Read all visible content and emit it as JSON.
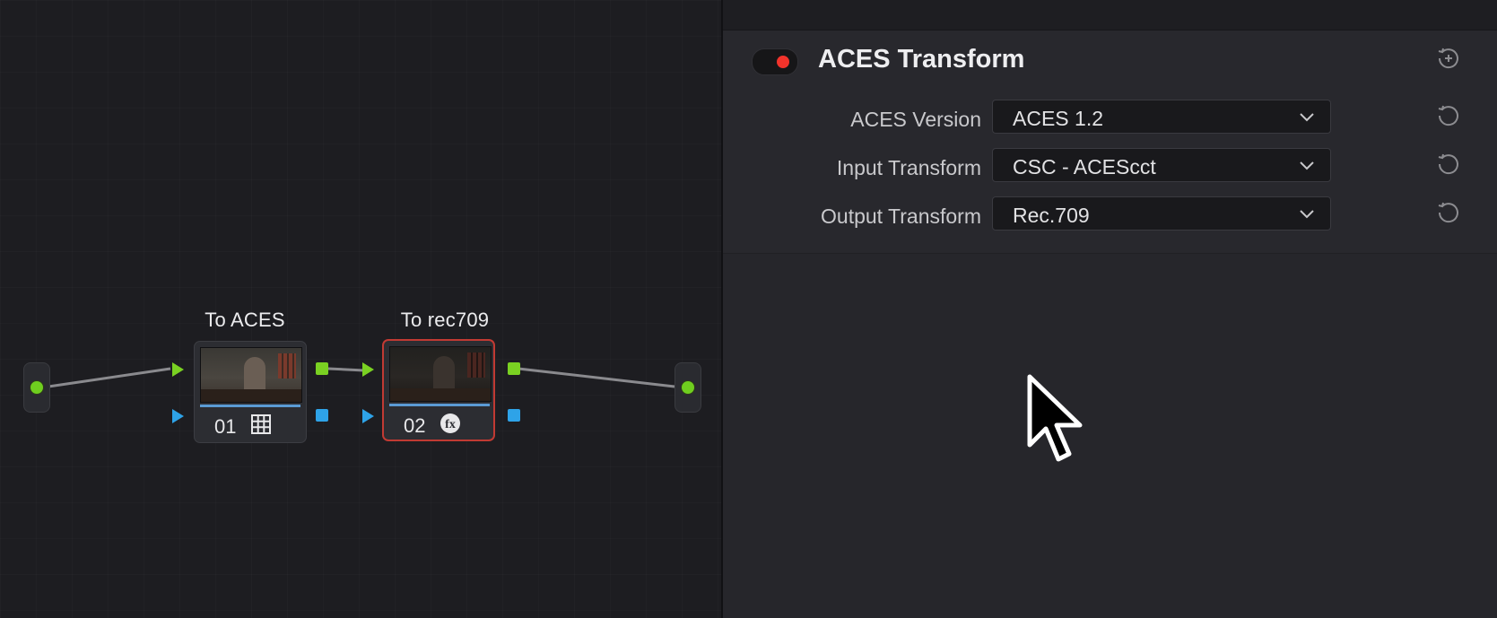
{
  "node_editor": {
    "nodes": [
      {
        "label": "To ACES",
        "number": "01",
        "icon": "grid-icon",
        "selected": false
      },
      {
        "label": "To rec709",
        "number": "02",
        "icon": "fx-icon",
        "selected": true
      }
    ],
    "colors": {
      "wire": "#8a8a8e",
      "rgb_port": "#7ad122",
      "alpha_port": "#2ea3e8",
      "source_dot": "#6fce1f",
      "selection": "#c13a33"
    }
  },
  "effect_panel": {
    "title": "ACES Transform",
    "enabled": true,
    "toggle_color": "#f2332b",
    "header_reset_icon": "reset-add-icon",
    "rows": [
      {
        "label": "ACES Version",
        "value": "ACES 1.2"
      },
      {
        "label": "Input Transform",
        "value": "CSC - ACEScct"
      },
      {
        "label": "Output Transform",
        "value": "Rec.709"
      }
    ]
  },
  "cursor": "arrow-pointer-icon"
}
